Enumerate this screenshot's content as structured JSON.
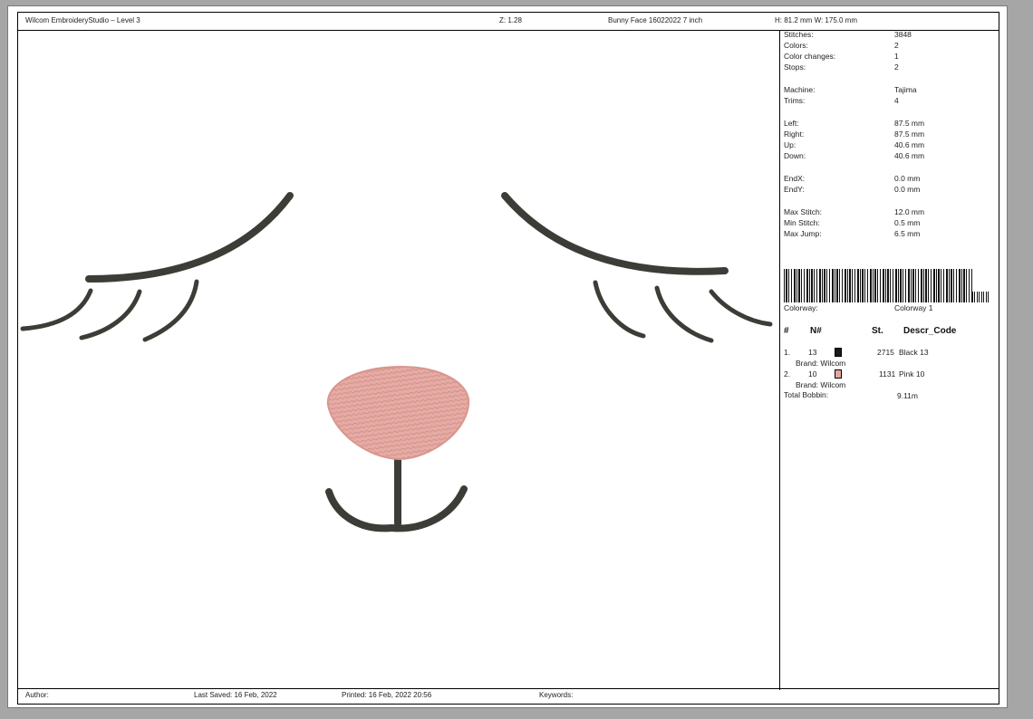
{
  "header": {
    "app_title": "Wilcom EmbroideryStudio – Level 3",
    "zoom": "Z: 1.28",
    "design_name": "Bunny Face 16022022 7 inch",
    "dimensions": "H: 81.2 mm  W: 175.0 mm"
  },
  "stats": [
    {
      "label": "Stitches:",
      "value": "3848"
    },
    {
      "label": "Colors:",
      "value": "2"
    },
    {
      "label": "Color changes:",
      "value": "1"
    },
    {
      "label": "Stops:",
      "value": "2"
    },
    {
      "label": "Machine:",
      "value": "Tajima"
    },
    {
      "label": "Trims:",
      "value": "4"
    },
    {
      "label": "Left:",
      "value": "87.5 mm"
    },
    {
      "label": "Right:",
      "value": "87.5 mm"
    },
    {
      "label": "Up:",
      "value": "40.6 mm"
    },
    {
      "label": "Down:",
      "value": "40.6 mm"
    },
    {
      "label": "EndX:",
      "value": "0.0 mm"
    },
    {
      "label": "EndY:",
      "value": "0.0 mm"
    },
    {
      "label": "Max Stitch:",
      "value": "12.0 mm"
    },
    {
      "label": "Min Stitch:",
      "value": "0.5 mm"
    },
    {
      "label": "Max Jump:",
      "value": "6.5 mm"
    }
  ],
  "colorway": {
    "label": "Colorway:",
    "value": "Colorway 1"
  },
  "color_table": {
    "headers": {
      "num": "#",
      "needle": "N#",
      "stitches": "St.",
      "descr": "Descr_Code"
    },
    "rows": [
      {
        "index": "1.",
        "needle": "13",
        "swatch": "#1b1b1b",
        "stitches": "2715",
        "descr": "Black 13",
        "brand": "Brand: Wilcom"
      },
      {
        "index": "2.",
        "needle": "10",
        "swatch": "#e4a7a1",
        "stitches": "1131",
        "descr": "Pink 10",
        "brand": "Brand: Wilcom"
      }
    ],
    "total_bobbin_label": "Total Bobbin:",
    "total_bobbin_value": "9.11m"
  },
  "footer": {
    "author": "Author:",
    "last_saved": "Last Saved: 16 Feb, 2022",
    "printed": "Printed: 16 Feb, 2022 20:56",
    "keywords": "Keywords:"
  },
  "colors": {
    "thread_dark": "#3d3d38",
    "thread_pink": "#e2a49c"
  }
}
